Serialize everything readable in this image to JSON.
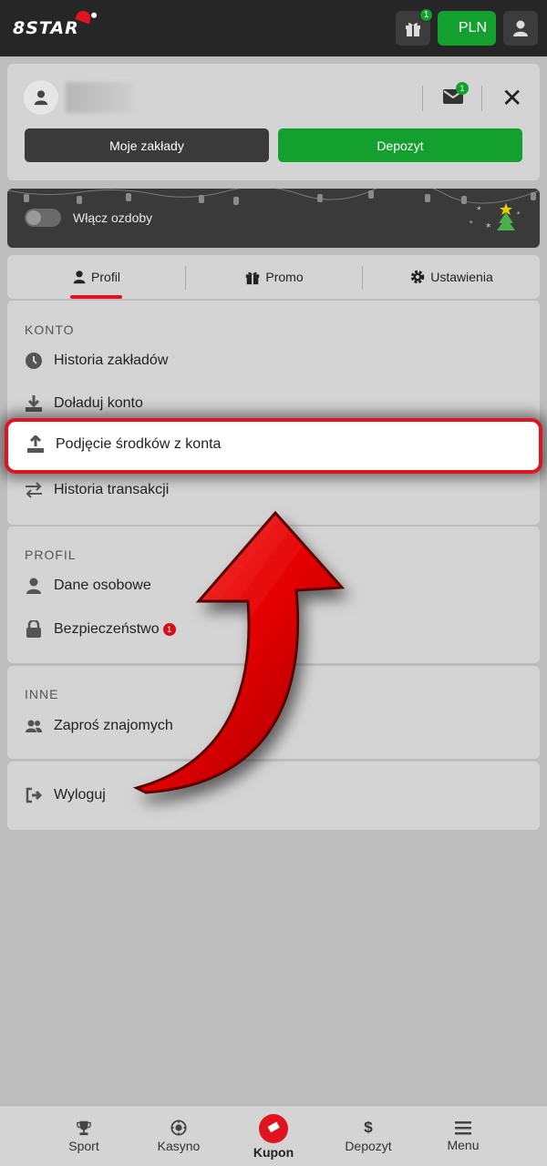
{
  "header": {
    "logo_text": "8STAR",
    "gift_badge": "1",
    "currency": "PLN"
  },
  "account": {
    "mail_badge": "1",
    "my_bets_label": "Moje zakłady",
    "deposit_label": "Depozyt"
  },
  "decorations": {
    "toggle_label": "Włącz ozdoby"
  },
  "tabs": [
    {
      "label": "Profil"
    },
    {
      "label": "Promo"
    },
    {
      "label": "Ustawienia"
    }
  ],
  "sections": {
    "konto": {
      "title": "KONTO",
      "items": [
        "Historia zakładów",
        "Doładuj konto",
        "Podjęcie środków z konta",
        "Historia transakcji"
      ]
    },
    "profil": {
      "title": "PROFIL",
      "items": [
        "Dane osobowe",
        "Bezpieczeństwo"
      ],
      "security_badge": "1"
    },
    "inne": {
      "title": "INNE",
      "items": [
        "Zaproś znajomych"
      ]
    },
    "logout_label": "Wyloguj"
  },
  "bottom_nav": [
    {
      "label": "Sport"
    },
    {
      "label": "Kasyno"
    },
    {
      "label": "Kupon"
    },
    {
      "label": "Depozyt"
    },
    {
      "label": "Menu"
    }
  ],
  "colors": {
    "brand_red": "#e0141e",
    "brand_green": "#14a02e",
    "dark": "#262626"
  }
}
